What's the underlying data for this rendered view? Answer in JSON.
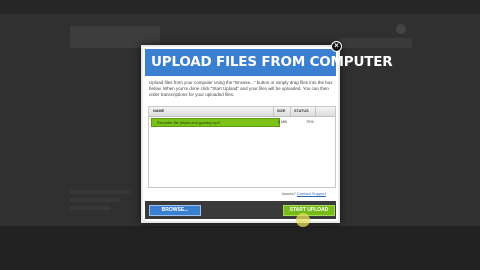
{
  "dialog": {
    "title": "UPLOAD FILES FROM COMPUTER",
    "close_glyph": "×",
    "description": "Upload files from your computer using the \"Browse...\" button or simply drag files into the box below. When you're done click \"Start Upload\" and your files will be uploaded. You can then order transcriptions for your uploaded files.",
    "table": {
      "columns": [
        "NAME",
        "SIZE",
        "STATUS"
      ],
      "rows": [
        {
          "name": "Recorder file (Maria and guests).mp3",
          "size": "6 MB",
          "status": "70%",
          "progress": 0.7
        }
      ]
    },
    "help_text": "Issues?",
    "help_link": "Contact Support",
    "browse_label": "BROWSE...",
    "upload_label": "START UPLOAD"
  },
  "colors": {
    "header": "#3b7fd0",
    "progress": "#7cc21a",
    "upload_button": "#76bb18",
    "browse_button": "#3b7fd0"
  }
}
